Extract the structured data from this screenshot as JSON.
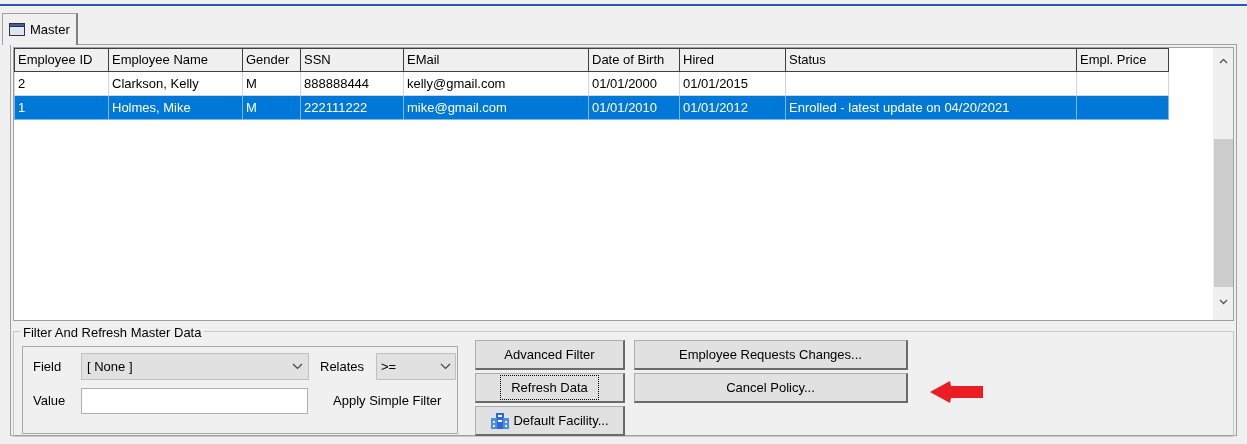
{
  "tabs": [
    {
      "label": "Master",
      "selected": true
    }
  ],
  "table": {
    "columns": [
      "Employee ID",
      "Employee Name",
      "Gender",
      "SSN",
      "EMail",
      "Date of Birth",
      "Hired",
      "Status",
      "Empl. Price"
    ],
    "rows": [
      {
        "selected": false,
        "cells": [
          "2",
          "Clarkson, Kelly",
          "M",
          "888888444",
          "kelly@gmail.com",
          "01/01/2000",
          "01/01/2015",
          "",
          ""
        ]
      },
      {
        "selected": true,
        "cells": [
          "1",
          "Holmes, Mike",
          "M",
          "222111222",
          "mike@gmail.com",
          "01/01/2010",
          "01/01/2012",
          "Enrolled - latest update on 04/20/2021",
          ""
        ]
      }
    ]
  },
  "filter_group": {
    "title": "Filter And Refresh Master Data",
    "field_label": "Field",
    "field_value": "[ None ]",
    "relates_label": "Relates",
    "relates_value": ">=",
    "value_label": "Value",
    "apply_label": "Apply Simple Filter"
  },
  "buttons": [
    {
      "label": "Advanced Filter",
      "focused": false,
      "icon": false
    },
    {
      "label": "Refresh Data",
      "focused": true,
      "icon": false
    },
    {
      "label": "Default Facility...",
      "focused": false,
      "icon": true
    }
  ],
  "policy_buttons": [
    "Employee Requests Changes...",
    "Cancel Policy..."
  ]
}
